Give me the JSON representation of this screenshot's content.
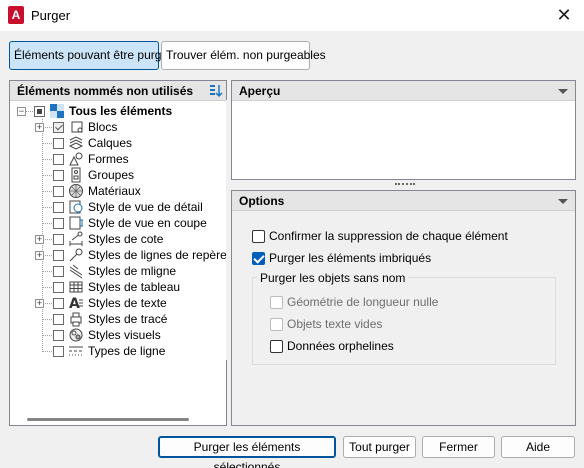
{
  "window": {
    "title": "Purger"
  },
  "tabs": {
    "purgeable": "Éléments pouvant être purgés",
    "non_purgeable": "Trouver élém. non purgeables"
  },
  "tree_panel": {
    "header": "Éléments nommés non utilisés",
    "root": "Tous les éléments",
    "items": [
      {
        "label": "Blocs",
        "expandable": true,
        "check": "checked-gray"
      },
      {
        "label": "Calques",
        "expandable": false
      },
      {
        "label": "Formes",
        "expandable": false
      },
      {
        "label": "Groupes",
        "expandable": false
      },
      {
        "label": "Matériaux",
        "expandable": false
      },
      {
        "label": "Style de vue de détail",
        "expandable": false
      },
      {
        "label": "Style de vue en coupe",
        "expandable": false
      },
      {
        "label": "Styles de cote",
        "expandable": true
      },
      {
        "label": "Styles de lignes de repère mu",
        "expandable": true
      },
      {
        "label": "Styles de mligne",
        "expandable": false
      },
      {
        "label": "Styles de tableau",
        "expandable": false
      },
      {
        "label": "Styles de texte",
        "expandable": true
      },
      {
        "label": "Styles de tracé",
        "expandable": false
      },
      {
        "label": "Styles visuels",
        "expandable": false
      },
      {
        "label": "Types de ligne",
        "expandable": false
      }
    ]
  },
  "preview_panel": {
    "header": "Aperçu"
  },
  "options_panel": {
    "header": "Options",
    "confirm_each": "Confirmer la suppression de chaque élément",
    "purge_nested": "Purger les éléments imbriqués",
    "unnamed_group": "Purger les objets sans nom",
    "zero_length": "Géométrie de longueur nulle",
    "empty_text": "Objets texte vides",
    "orphaned_data": "Données orphelines"
  },
  "buttons": {
    "purge_selected": "Purger les éléments sélectionnés",
    "purge_all": "Tout purger",
    "close": "Fermer",
    "help": "Aide"
  }
}
